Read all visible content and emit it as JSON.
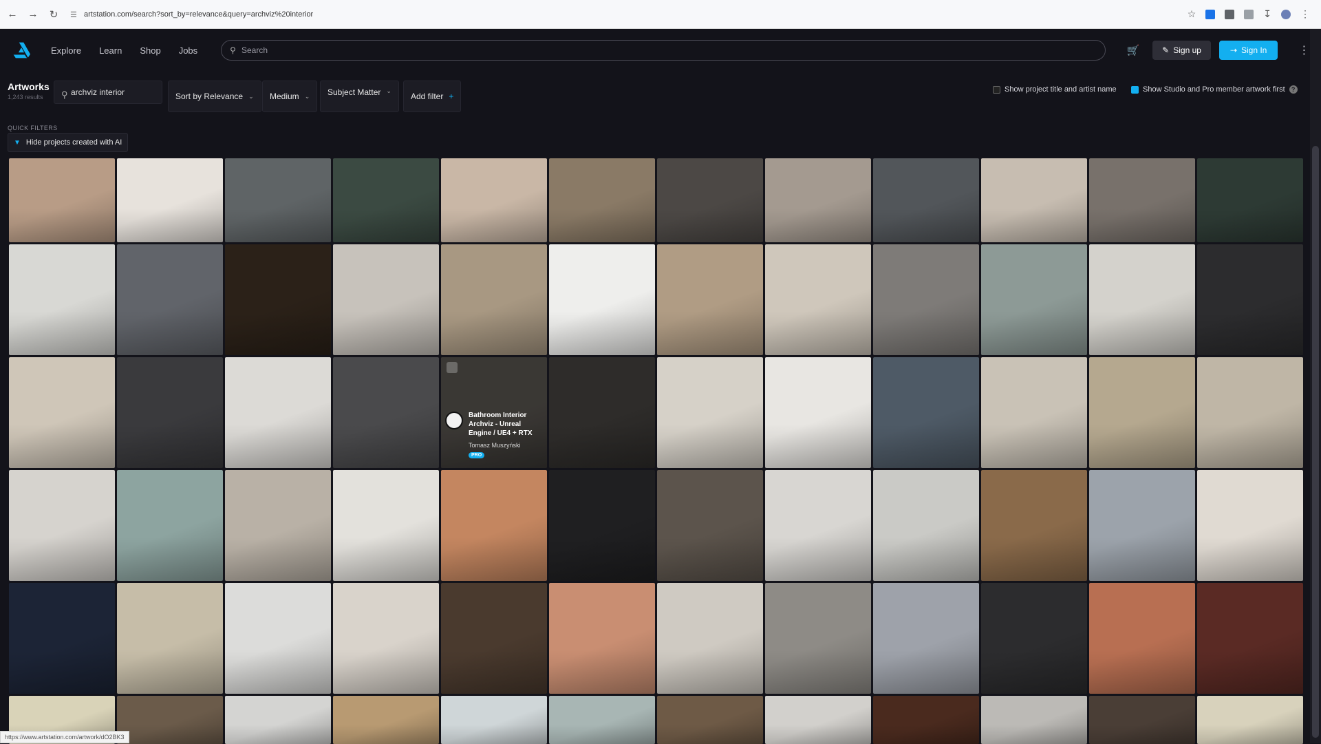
{
  "browser": {
    "url": "artstation.com/search?sort_by=relevance&query=archviz%20interior",
    "status_url": "https://www.artstation.com/artwork/dO2BK3"
  },
  "header": {
    "nav": [
      "Explore",
      "Learn",
      "Shop",
      "Jobs"
    ],
    "search_placeholder": "Search",
    "signup_label": "Sign up",
    "signin_label": "Sign In"
  },
  "filters": {
    "title": "Artworks",
    "count": "1,243 results",
    "query": "archviz interior",
    "sort_label": "Sort by Relevance",
    "medium_label": "Medium",
    "subject_label": "Subject Matter",
    "add_filter_label": "Add filter",
    "show_project_title": "Show project title and artist name",
    "show_studio_pro": "Show Studio and Pro member artwork first"
  },
  "quick_filters": {
    "label": "QUICK FILTERS",
    "hide_ai": "Hide projects created with AI"
  },
  "hover_card": {
    "title": "Bathroom Interior Archviz - Unreal Engine / UE4 + RTX",
    "artist": "Tomasz Muszyński",
    "badge": "PRO"
  },
  "colors": {
    "accent": "#13aff0",
    "background": "#13131a"
  },
  "thumbnail_palette": [
    [
      "#b89c86",
      "#e7e2dc",
      "#5f6466",
      "#3b4a42",
      "#c9b7a6",
      "#8a7a66",
      "#4c4845",
      "#a49a90",
      "#52565a",
      "#c7bdb1",
      "#78716b",
      "#2d3a34"
    ],
    [
      "#d8d8d4",
      "#61646a",
      "#2b2118",
      "#c7c2bb",
      "#a89882",
      "#eeeeec",
      "#b09c84",
      "#cfc7bb",
      "#7e7b78",
      "#8d9a96",
      "#d4d2cc",
      "#2c2c2e"
    ],
    [
      "#cfc6b8",
      "#3a3a3d",
      "#dcdad6",
      "#4a4a4c",
      "#6b6660",
      "#2e2c2a",
      "#d6d1c8",
      "#e8e6e2",
      "#4e5a66",
      "#c9c2b6",
      "#b5a88f",
      "#bfb6a6"
    ],
    [
      "#d6d3ce",
      "#8da4a0",
      "#b9b1a6",
      "#e3e1dc",
      "#c48660",
      "#1f1f21",
      "#5c544c",
      "#d8d6d2",
      "#cacac6",
      "#8a6a4a",
      "#9ca3ab",
      "#e0dad2"
    ],
    [
      "#1c2436",
      "#c6bda8",
      "#dcdcda",
      "#d9d3cb",
      "#4a3a2e",
      "#c98e72",
      "#cfcac2",
      "#8e8b86",
      "#9ea2aa",
      "#2c2c2e",
      "#b86f52",
      "#5a2a24"
    ],
    [
      "#d9d3b8",
      "#6b5b4a",
      "#d4d4d2",
      "#b89a72",
      "#cfd6d8",
      "#a8b6b4",
      "#6e5a46",
      "#d2d0cc",
      "#4a2a1e",
      "#bcbab6",
      "#4a3e36",
      "#d8d2bc"
    ]
  ]
}
